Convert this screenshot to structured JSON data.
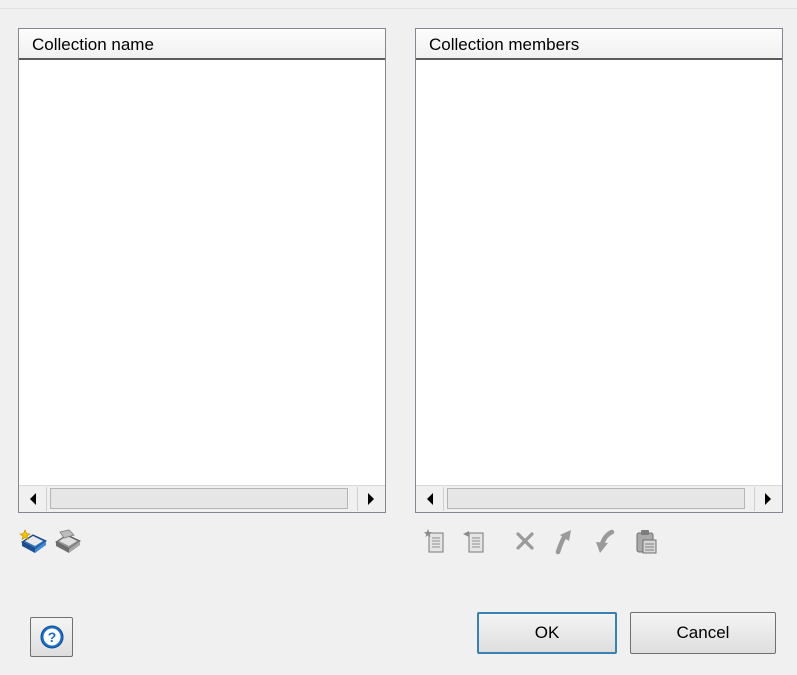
{
  "collection_panel": {
    "header": "Collection name"
  },
  "members_panel": {
    "header": "Collection members"
  },
  "collection_toolbar": {
    "icons": [
      "new-collection-icon",
      "delete-collection-icon"
    ]
  },
  "members_toolbar": {
    "icons": [
      "add-member-icon",
      "add-members-icon",
      "remove-member-icon",
      "move-up-icon",
      "move-down-icon",
      "paste-icon"
    ]
  },
  "footer": {
    "help_icon": "help-icon",
    "help_label": "?",
    "ok_label": "OK",
    "cancel_label": "Cancel"
  },
  "colors": {
    "dialog_background": "#f0f0f0",
    "header_divider": "#5b5b5b",
    "help_blue": "#1e6fc9",
    "disabled_icon": "#9e9e9e",
    "default_button_border": "#3c7fb1"
  }
}
